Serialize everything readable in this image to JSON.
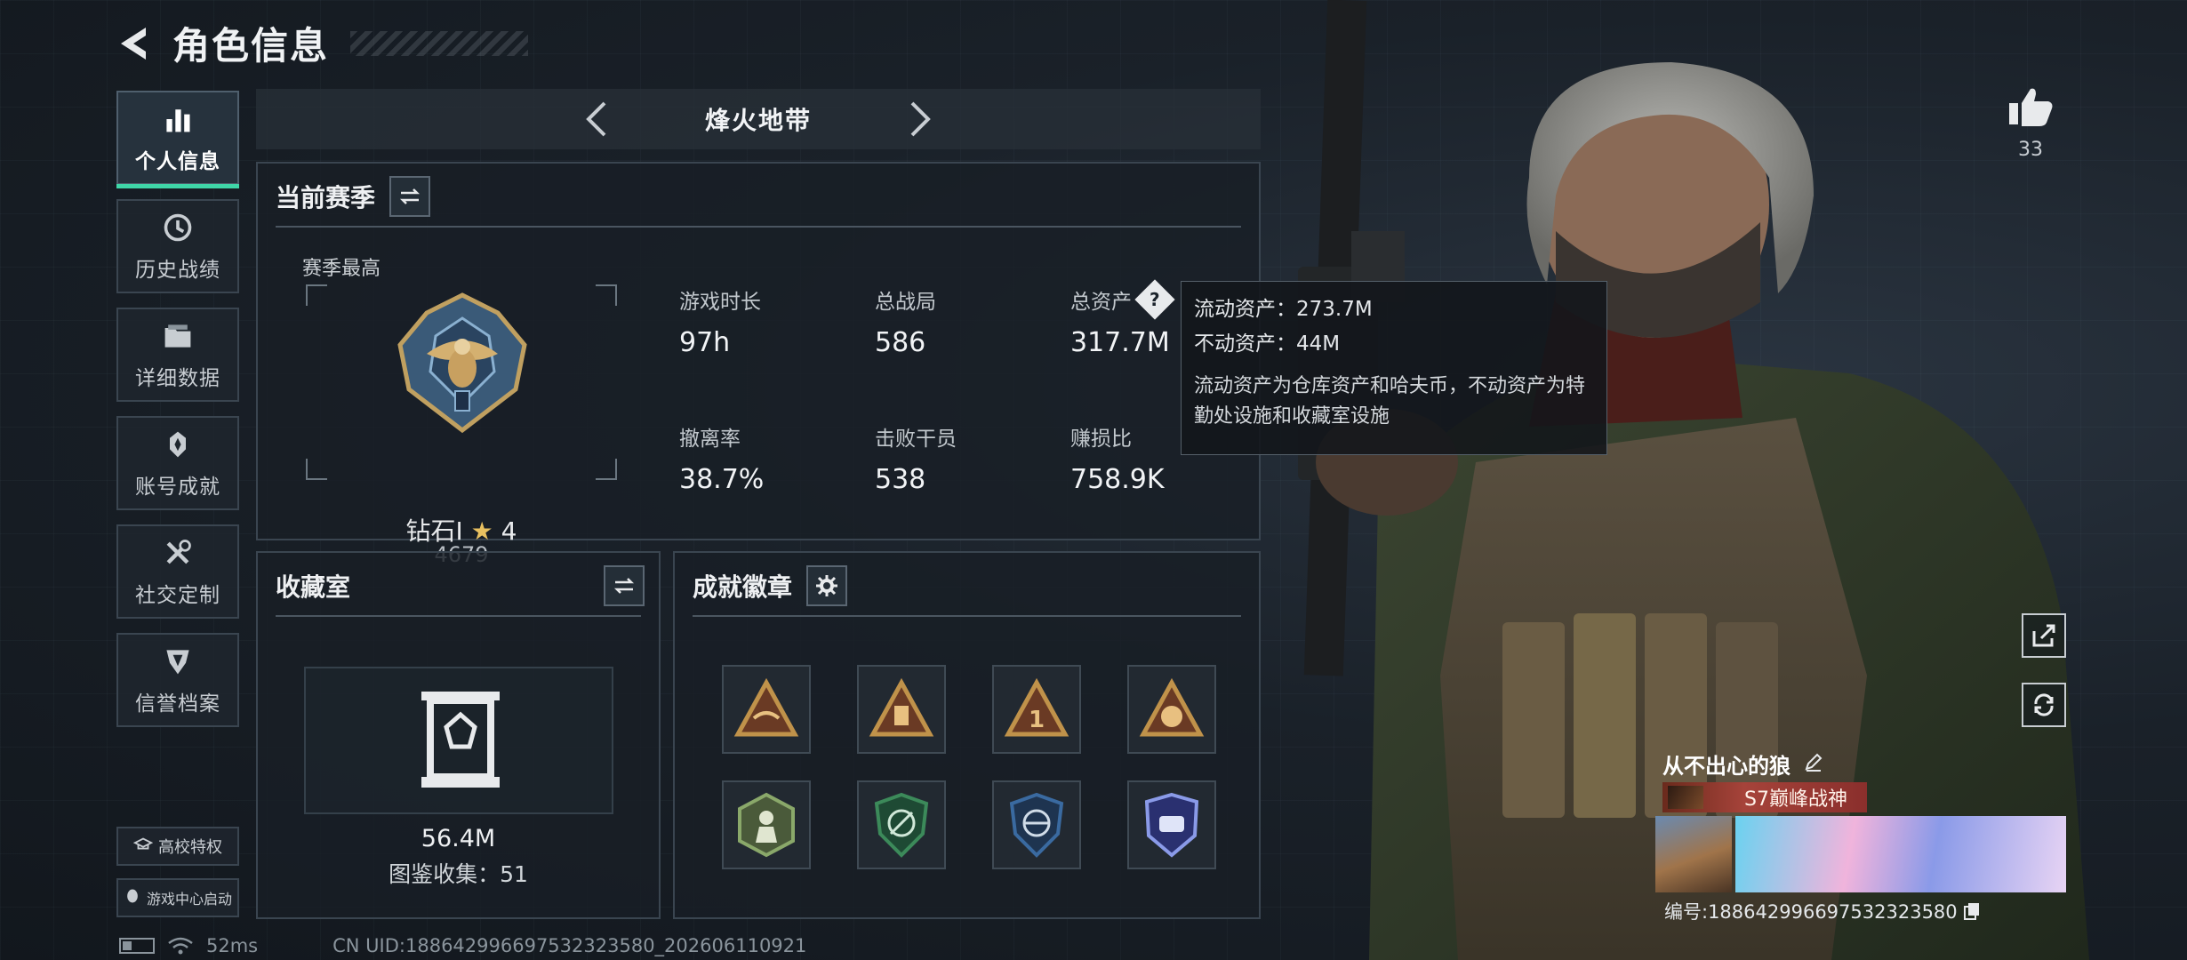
{
  "header": {
    "title": "角色信息"
  },
  "sidebar": {
    "items": [
      {
        "label": "个人信息",
        "icon": "bar-chart-icon"
      },
      {
        "label": "历史战绩",
        "icon": "history-icon"
      },
      {
        "label": "详细数据",
        "icon": "folder-icon"
      },
      {
        "label": "账号成就",
        "icon": "achievement-icon"
      },
      {
        "label": "社交定制",
        "icon": "tools-icon"
      },
      {
        "label": "信誉档案",
        "icon": "credit-shield-icon"
      }
    ],
    "campus_label": "高校特权",
    "game_center_label": "游戏中心启动"
  },
  "mode": {
    "title": "烽火地带"
  },
  "season": {
    "title": "当前赛季",
    "best_label": "赛季最高",
    "rank_name": "钻石Ⅰ",
    "rank_stars": "4",
    "rank_score": "4679",
    "stats": [
      {
        "label": "游戏时长",
        "value": "97h"
      },
      {
        "label": "总战局",
        "value": "586"
      },
      {
        "label": "总资产",
        "value": "317.7M"
      },
      {
        "label": "撤离率",
        "value": "38.7%"
      },
      {
        "label": "击败干员",
        "value": "538"
      },
      {
        "label": "赚损比",
        "value": "758.9K"
      }
    ]
  },
  "tooltip": {
    "liquid": "流动资产：273.7M",
    "fixed": "不动资产：44M",
    "desc": "流动资产为仓库资产和哈夫币，不动资产为特勤处设施和收藏室设施"
  },
  "collection": {
    "title": "收藏室",
    "value": "56.4M",
    "count": "图鉴收集：51"
  },
  "badges": {
    "title": "成就徽章",
    "colors": [
      "#c0924a",
      "#c0924a",
      "#c0924a",
      "#c0924a",
      "#8aa86a",
      "#3c8a5a",
      "#3a6aa0",
      "#5a6ad0"
    ]
  },
  "profile": {
    "likes": "33",
    "nickname": "从不出心的狼",
    "title_tag": "S7巅峰战神",
    "serial": "编号:18864299669753232358​0"
  },
  "footer": {
    "ping": "52ms",
    "uid": "CN UID:18864299669753232358​0_202606110921"
  }
}
